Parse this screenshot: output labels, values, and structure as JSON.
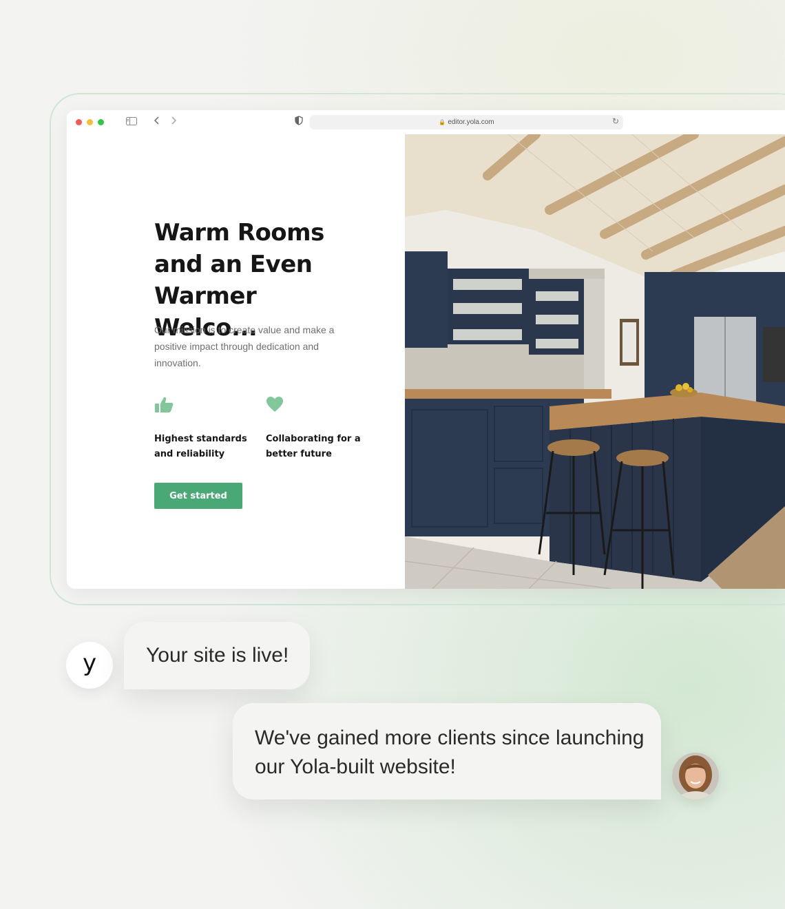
{
  "browser": {
    "address_url": "editor.yola.com",
    "icons": [
      "sidebar-icon",
      "back-icon",
      "forward-icon",
      "shield-icon",
      "lock-icon",
      "reload-icon"
    ]
  },
  "hero": {
    "title": "Warm Rooms and an Even Warmer Welco...",
    "description": "Our mission is to create value and make a positive impact through dedication and innovation.",
    "features": [
      {
        "icon": "thumbs-up-icon",
        "label": "Highest standards and reliability"
      },
      {
        "icon": "heart-icon",
        "label": "Collaborating for a better future"
      }
    ],
    "cta_label": "Get started"
  },
  "chat": {
    "yola_avatar": "y",
    "message_1": "Your site is live!",
    "message_2": "We've gained more clients since launching our Yola-built website!"
  },
  "colors": {
    "accent": "#4aa877",
    "icon_green": "#82c79b",
    "cabinet_navy": "#2c3a52"
  }
}
